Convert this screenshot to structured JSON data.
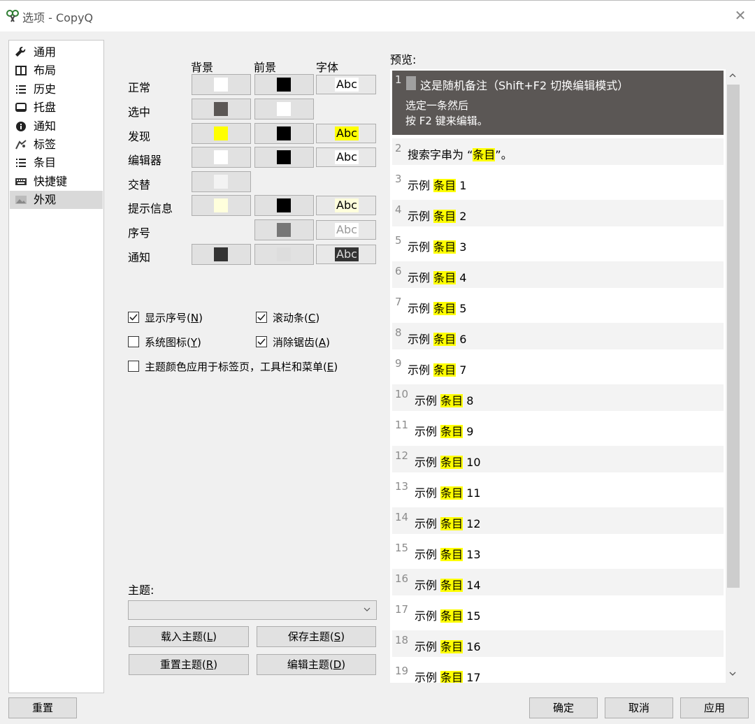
{
  "window": {
    "title": "选项 - CopyQ"
  },
  "sidebar": {
    "items": [
      {
        "label": "通用",
        "icon": "wrench-icon"
      },
      {
        "label": "布局",
        "icon": "layout-icon"
      },
      {
        "label": "历史",
        "icon": "list-icon"
      },
      {
        "label": "托盘",
        "icon": "tray-icon"
      },
      {
        "label": "通知",
        "icon": "info-icon"
      },
      {
        "label": "标签",
        "icon": "tag-icon"
      },
      {
        "label": "条目",
        "icon": "list-icon"
      },
      {
        "label": "快捷键",
        "icon": "keyboard-icon"
      },
      {
        "label": "外观",
        "icon": "image-icon",
        "active": true
      }
    ]
  },
  "appearance": {
    "columns": {
      "background": "背景",
      "foreground": "前景",
      "font": "字体"
    },
    "font_sample": "Abc",
    "rows": [
      {
        "label": "正常",
        "bg": "#ffffff",
        "fg": "#000000",
        "font": true,
        "font_bg": "#ffffff",
        "font_fg": "#000000"
      },
      {
        "label": "选中",
        "bg": "#5b5755",
        "fg": "#ffffff",
        "font": false
      },
      {
        "label": "发现",
        "bg": "#ffff00",
        "fg": "#000000",
        "font": true,
        "font_bg": "#ffff00",
        "font_fg": "#000000"
      },
      {
        "label": "编辑器",
        "bg": "#ffffff",
        "fg": "#000000",
        "font": true,
        "font_bg": "#ffffff",
        "font_fg": "#000000"
      },
      {
        "label": "交替",
        "bg": "#f3f3f3",
        "fg": null,
        "font": false
      },
      {
        "label": "提示信息",
        "bg": "#ffffdc",
        "fg": "#000000",
        "font": true,
        "font_bg": "#ffffdc",
        "font_fg": "#000000"
      },
      {
        "label": "序号",
        "bg": null,
        "fg": "#777777",
        "font": true,
        "font_bg": "#ffffff",
        "font_fg": "#999999"
      },
      {
        "label": "通知",
        "bg": "#333333",
        "fg": "#dddddd",
        "font": true,
        "font_bg": "#333333",
        "font_fg": "#dddddd"
      }
    ],
    "checkboxes": {
      "show_number": {
        "label": "显示序号(",
        "key": "N",
        "end": ")",
        "checked": true
      },
      "scrollbar": {
        "label": "滚动条(",
        "key": "C",
        "end": ")",
        "checked": true
      },
      "system_icons": {
        "label": "系统图标(",
        "key": "Y",
        "end": ")",
        "checked": false
      },
      "antialias": {
        "label": "消除锯齿(",
        "key": "A",
        "end": ")",
        "checked": true
      },
      "theme_apply": {
        "label": "主题颜色应用于标签页，工具栏和菜单(",
        "key": "E",
        "end": ")",
        "checked": false
      }
    },
    "theme": {
      "label": "主题:",
      "value": "",
      "load": {
        "label": "载入主题(",
        "key": "L",
        "end": ")"
      },
      "save": {
        "label": "保存主题(",
        "key": "S",
        "end": ")"
      },
      "reset": {
        "label": "重置主题(",
        "key": "R",
        "end": ")"
      },
      "edit": {
        "label": "编辑主题(",
        "key": "D",
        "end": ")"
      }
    }
  },
  "preview": {
    "label": "预览:",
    "selected": {
      "num": "1",
      "line1": "这是随机备注（Shift+F2 切换编辑模式）",
      "line2": "选定一条然后",
      "line3": "按 F2 键来编辑。"
    },
    "search_item": {
      "num": "2",
      "prefix": "搜索字串为 “",
      "highlight": "条目",
      "suffix": "”。"
    },
    "item_prefix": "示例",
    "item_highlight": "条目",
    "items": [
      {
        "num": "3",
        "n": "1"
      },
      {
        "num": "4",
        "n": "2"
      },
      {
        "num": "5",
        "n": "3"
      },
      {
        "num": "6",
        "n": "4"
      },
      {
        "num": "7",
        "n": "5"
      },
      {
        "num": "8",
        "n": "6"
      },
      {
        "num": "9",
        "n": "7"
      },
      {
        "num": "10",
        "n": "8"
      },
      {
        "num": "11",
        "n": "9"
      },
      {
        "num": "12",
        "n": "10"
      },
      {
        "num": "13",
        "n": "11"
      },
      {
        "num": "14",
        "n": "12"
      },
      {
        "num": "15",
        "n": "13"
      },
      {
        "num": "16",
        "n": "14"
      },
      {
        "num": "17",
        "n": "15"
      },
      {
        "num": "18",
        "n": "16"
      },
      {
        "num": "19",
        "n": "17"
      }
    ]
  },
  "footer": {
    "reset": "重置",
    "ok": "确定",
    "cancel": "取消",
    "apply": "应用"
  }
}
